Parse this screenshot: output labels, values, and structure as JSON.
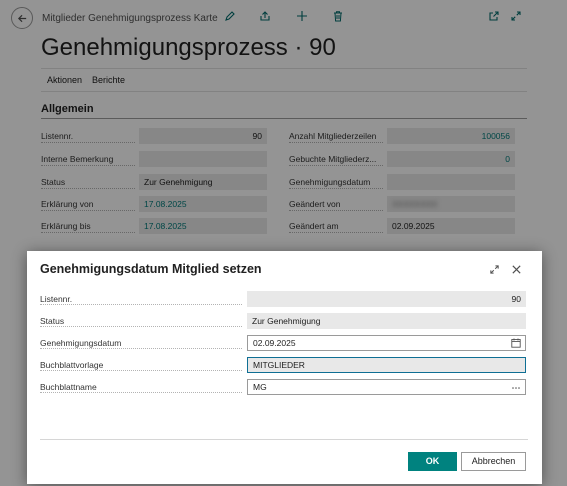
{
  "colors": {
    "accent": "#00827f",
    "link": "#007a7a",
    "focus_border": "#0f6f94"
  },
  "page": {
    "breadcrumb": "Mitglieder Genehmigungsprozess Karte",
    "title": "Genehmigungsprozess · 90",
    "toolbar_icons": [
      "edit-icon",
      "share-icon",
      "add-icon",
      "delete-icon",
      "open-in-new-window-icon",
      "expand-icon"
    ],
    "actions": {
      "aktionen": "Aktionen",
      "berichte": "Berichte"
    },
    "section": "Allgemein",
    "left_fields": [
      {
        "label": "Listennr.",
        "value": "90"
      },
      {
        "label": "Interne Bemerkung",
        "value": ""
      },
      {
        "label": "Status",
        "value": "Zur Genehmigung"
      },
      {
        "label": "Erklärung von",
        "value": "17.08.2025"
      },
      {
        "label": "Erklärung bis",
        "value": "17.08.2025"
      }
    ],
    "right_fields": [
      {
        "label": "Anzahl Mitgliederzeilen",
        "value": "100056"
      },
      {
        "label": "Gebuchte Mitgliederz...",
        "value": "0"
      },
      {
        "label": "Genehmigungsdatum",
        "value": ""
      },
      {
        "label": "Geändert von",
        "value": "XXXXXXXX"
      },
      {
        "label": "Geändert am",
        "value": "02.09.2025"
      }
    ]
  },
  "dialog": {
    "title": "Genehmigungsdatum Mitglied setzen",
    "fields": [
      {
        "label": "Listennr.",
        "value": "90"
      },
      {
        "label": "Status",
        "value": "Zur Genehmigung"
      },
      {
        "label": "Genehmigungsdatum",
        "value": "02.09.2025",
        "icon": "calendar-icon"
      },
      {
        "label": "Buchblattvorlage",
        "value": "MITGLIEDER"
      },
      {
        "label": "Buchblattname",
        "value": "MG",
        "icon": "more-options-icon"
      }
    ],
    "ok_label": "OK",
    "cancel_label": "Abbrechen"
  }
}
